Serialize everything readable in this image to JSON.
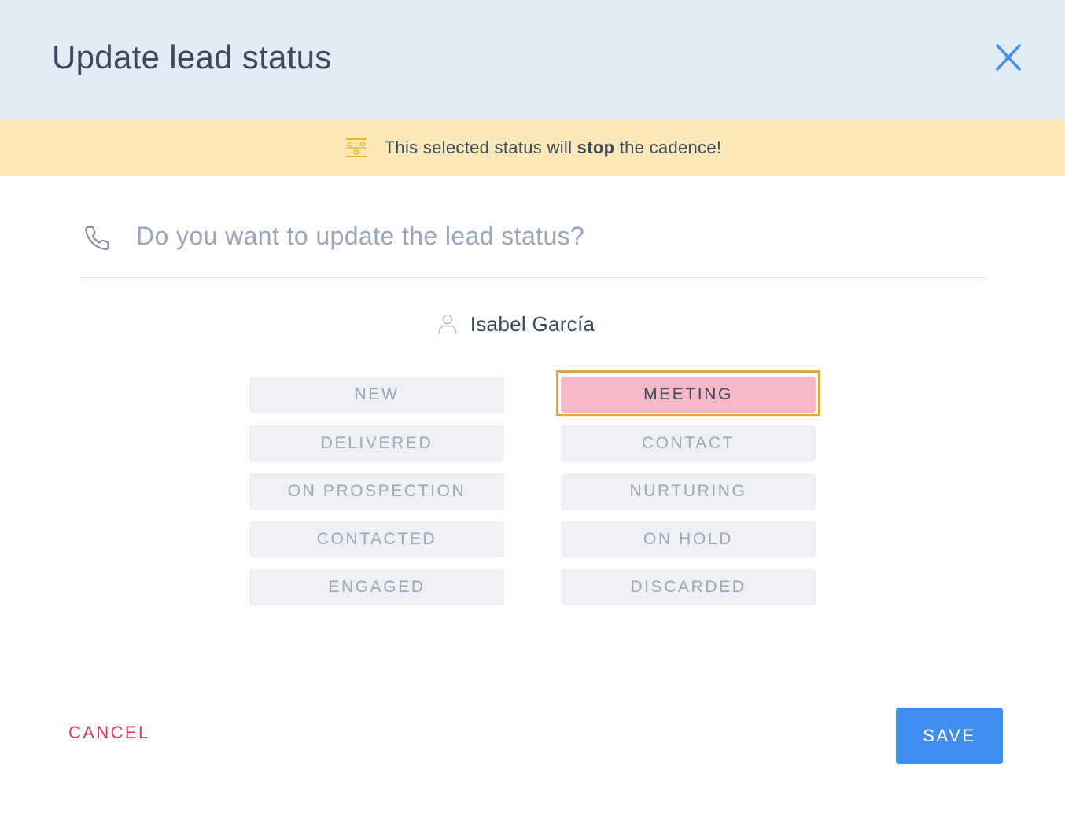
{
  "header": {
    "title": "Update lead status",
    "close_icon": "close-icon"
  },
  "banner": {
    "icon": "cadence-icon",
    "text_before": "This selected status will ",
    "text_bold": "stop",
    "text_after": " the cadence!",
    "background": "#fce8b8"
  },
  "question": {
    "icon": "phone-icon",
    "text": "Do you want to update the lead status?"
  },
  "lead": {
    "icon": "person-icon",
    "name": "Isabel García"
  },
  "statuses": {
    "left": [
      "NEW",
      "DELIVERED",
      "ON PROSPECTION",
      "CONTACTED",
      "ENGAGED"
    ],
    "right": [
      "MEETING",
      "CONTACT",
      "NURTURING",
      "ON HOLD",
      "DISCARDED"
    ],
    "selected": "MEETING",
    "selected_color": "#f4b8c6",
    "highlight_color": "#f0a23a"
  },
  "footer": {
    "cancel_label": "CANCEL",
    "save_label": "SAVE",
    "cancel_color": "#e03a5c",
    "save_color": "#3f8ef0"
  }
}
